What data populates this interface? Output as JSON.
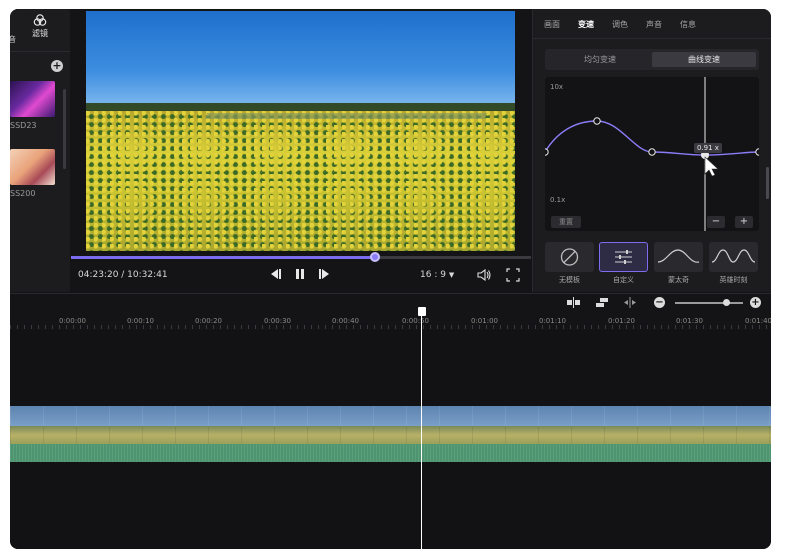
{
  "library": {
    "filter_tab_label": "滤镜",
    "cut_label": "音",
    "items": [
      {
        "label": "SSD23"
      },
      {
        "label": "SS200"
      }
    ]
  },
  "player": {
    "timecode": "04:23:20 / 10:32:41",
    "aspect_ratio": "16 : 9",
    "progress": 0.66
  },
  "inspector": {
    "tabs": [
      {
        "label": "画面",
        "active": false
      },
      {
        "label": "变速",
        "active": true
      },
      {
        "label": "调色",
        "active": false
      },
      {
        "label": "声音",
        "active": false
      },
      {
        "label": "信息",
        "active": false
      }
    ],
    "speed_modes": [
      {
        "label": "均匀变速",
        "active": false
      },
      {
        "label": "曲线变速",
        "active": true
      }
    ],
    "curve": {
      "max_label": "10x",
      "min_label": "0.1x",
      "point_value_label": "0.91 x",
      "reset_label": "重置",
      "minus_label": "−",
      "plus_label": "+"
    },
    "presets": [
      {
        "label": "无模板",
        "icon": "none-icon",
        "selected": false
      },
      {
        "label": "自定义",
        "icon": "custom-sliders-icon",
        "selected": true
      },
      {
        "label": "蒙太奇",
        "icon": "montage-curve-icon",
        "selected": false
      },
      {
        "label": "英雄时刻",
        "icon": "hero-curve-icon",
        "selected": false
      }
    ]
  },
  "timeline": {
    "ruler": [
      "0:00:00",
      "0:00:10",
      "0:00:20",
      "0:00:30",
      "0:00:40",
      "0:00:50",
      "0:01:00",
      "0:01:10",
      "0:01:20",
      "0:01:30",
      "0:01:40"
    ],
    "zoom_level": 0.75
  },
  "colors": {
    "accent": "#7b6cf0",
    "background": "#141416",
    "panel": "#1c1c1f"
  }
}
